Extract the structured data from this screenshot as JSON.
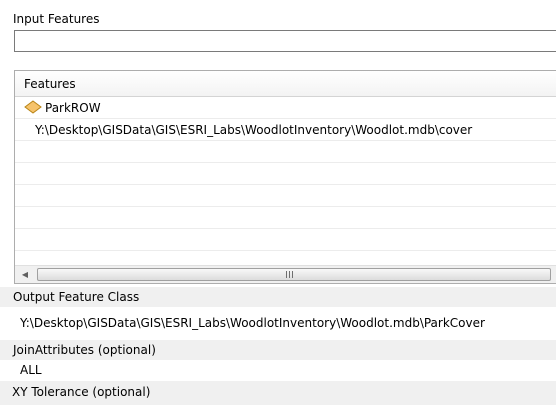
{
  "input_features": {
    "label": "Input Features",
    "value": ""
  },
  "features_list": {
    "header": "Features",
    "items": [
      {
        "name": "ParkROW",
        "path": "Y:\\Desktop\\GISData\\GIS\\ESRI_Labs\\WoodlotInventory\\Woodlot.mdb\\cover"
      }
    ],
    "geometry_icon": "polygon-feature-class-icon"
  },
  "output_feature_class": {
    "label": "Output Feature Class",
    "value": "Y:\\Desktop\\GISData\\GIS\\ESRI_Labs\\WoodlotInventory\\Woodlot.mdb\\ParkCover"
  },
  "join_attributes": {
    "label": "JoinAttributes (optional)",
    "value": "ALL"
  },
  "xy_tolerance": {
    "label": "XY Tolerance (optional)"
  },
  "colors": {
    "panel_shade": "#f0f0f0",
    "icon_fill": "#f6c36b",
    "icon_stroke": "#b88416"
  }
}
